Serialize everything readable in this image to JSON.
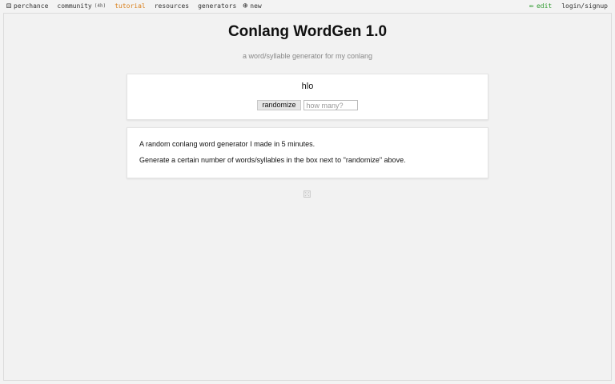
{
  "nav": {
    "left": [
      {
        "icon": "⚄",
        "label": "perchance"
      },
      {
        "icon": "",
        "label": "community",
        "small": "(4h)"
      },
      {
        "icon": "",
        "label": "tutorial"
      },
      {
        "icon": "",
        "label": "resources"
      },
      {
        "icon": "",
        "label": "generators"
      },
      {
        "icon": "⊕",
        "label": "new"
      }
    ],
    "right": [
      {
        "icon": "✏",
        "label": "edit"
      },
      {
        "icon": "",
        "label": "login/signup"
      }
    ]
  },
  "page": {
    "title": "Conlang WordGen 1.0",
    "subtitle": "a word/syllable generator for my conlang"
  },
  "generator": {
    "output": "hlo",
    "randomize_label": "randomize",
    "count_placeholder": "how many?",
    "count_value": ""
  },
  "description": {
    "line1": "A random conlang word generator I made in 5 minutes.",
    "line2": "Generate a certain number of words/syllables in the box next to \"randomize\" above."
  },
  "footer": {
    "icon": "⚄"
  },
  "colors": {
    "tutorial": "#d97f1a",
    "edit": "#2f9a2f",
    "background": "#f3f3f3"
  }
}
